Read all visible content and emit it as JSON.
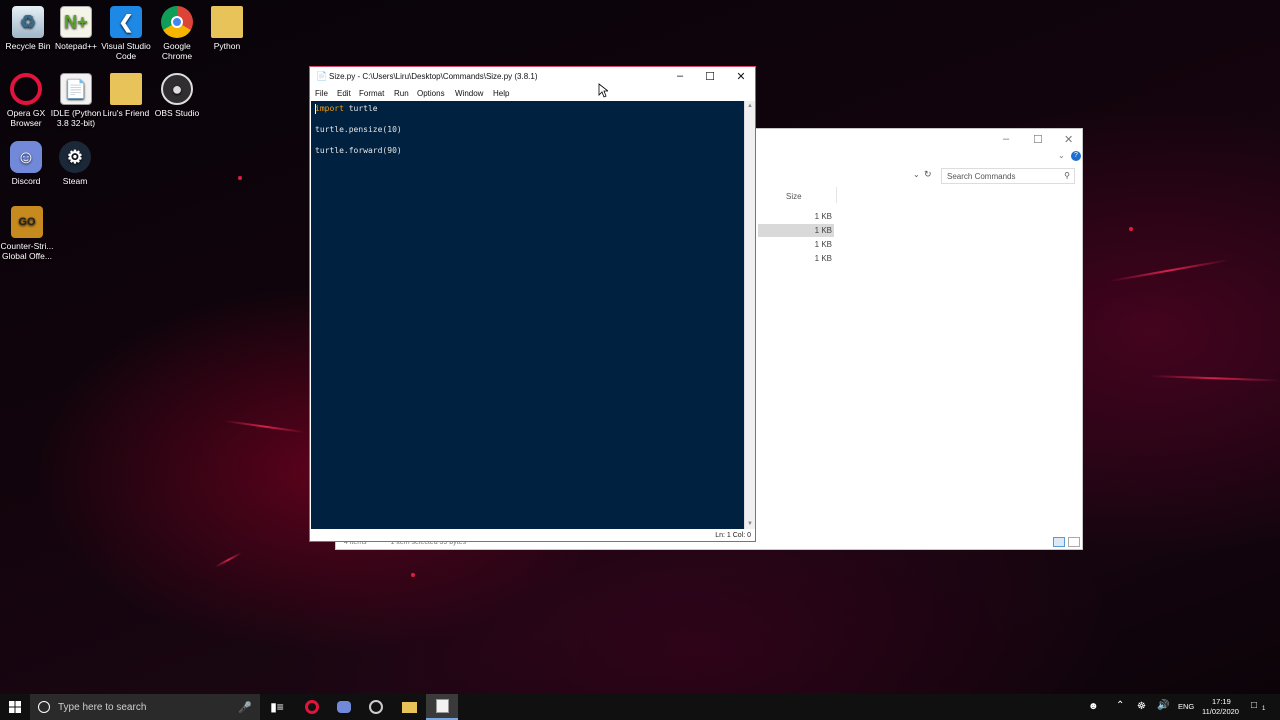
{
  "desktop": {
    "icons": [
      {
        "label": "Recycle Bin",
        "icon": "recycle-bin-icon"
      },
      {
        "label": "Notepad++",
        "icon": "notepad-plus-plus-icon"
      },
      {
        "label": "Visual Studio Code",
        "icon": "vscode-icon"
      },
      {
        "label": "Google Chrome",
        "icon": "chrome-icon"
      },
      {
        "label": "Python",
        "icon": "folder-icon"
      },
      {
        "label": "Opera GX Browser",
        "icon": "opera-gx-icon"
      },
      {
        "label": "IDLE (Python 3.8 32-bit)",
        "icon": "idle-icon"
      },
      {
        "label": "Liru's Friend",
        "icon": "folder-icon"
      },
      {
        "label": "OBS Studio",
        "icon": "obs-icon"
      },
      {
        "label": "Discord",
        "icon": "discord-icon"
      },
      {
        "label": "Steam",
        "icon": "steam-icon"
      },
      {
        "label": "Counter-Stri... Global Offe...",
        "icon": "csgo-icon"
      }
    ]
  },
  "idle_window": {
    "title": "Size.py - C:\\Users\\Liru\\Desktop\\Commands\\Size.py (3.8.1)",
    "menu": [
      "File",
      "Edit",
      "Format",
      "Run",
      "Options",
      "Window",
      "Help"
    ],
    "code": {
      "line1_kw": "import",
      "line1_rest": " turtle",
      "line2": "turtle.pensize(10)",
      "line3": "turtle.forward(90)"
    },
    "status": "Ln: 1   Col: 0",
    "colors": {
      "editor_bg": "#002240",
      "keyword": "#ff9d00",
      "border": "#d24a66"
    }
  },
  "explorer_window": {
    "search_placeholder": "Search Commands",
    "column_size": "Size",
    "rows": [
      "1 KB",
      "1 KB",
      "1 KB",
      "1 KB"
    ],
    "selected_row": 1,
    "status_items": "4 items",
    "status_selected": "1 item selected  39 bytes"
  },
  "taskbar": {
    "search_placeholder": "Type here to search",
    "language": "ENG",
    "time": "17:19",
    "date": "11/02/2020",
    "notification_count": "1"
  }
}
